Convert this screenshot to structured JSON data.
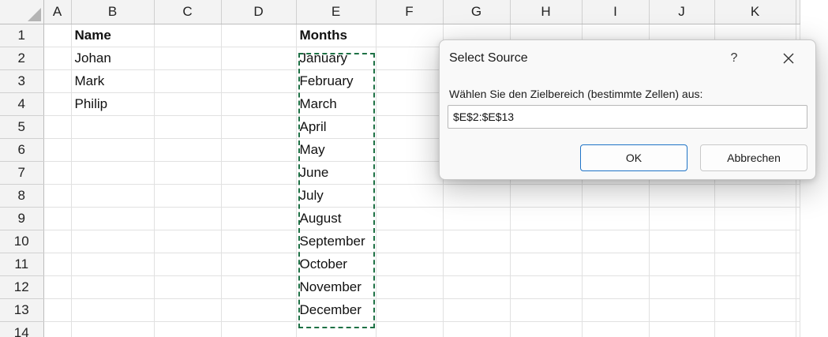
{
  "columns": [
    "A",
    "B",
    "C",
    "D",
    "E",
    "F",
    "G",
    "H",
    "I",
    "J",
    "K"
  ],
  "rows": [
    "1",
    "2",
    "3",
    "4",
    "5",
    "6",
    "7",
    "8",
    "9",
    "10",
    "11",
    "12",
    "13",
    "14"
  ],
  "cells": {
    "B1": "Name",
    "B2": "Johan",
    "B3": "Mark",
    "B4": "Philip",
    "E1": "Months",
    "E2": "January",
    "E3": "February",
    "E4": "March",
    "E5": "April",
    "E6": "May",
    "E7": "June",
    "E8": "July",
    "E9": "August",
    "E10": "September",
    "E11": "October",
    "E12": "November",
    "E13": "December"
  },
  "dialog": {
    "title": "Select Source",
    "help_label": "?",
    "prompt": "Wählen Sie den Zielbereich (bestimmte Zellen) aus:",
    "range_value": "$E$2:$E$13",
    "ok_label": "OK",
    "cancel_label": "Abbrechen"
  },
  "colors": {
    "selection_border": "#1e7145",
    "ok_border": "#1f74c7",
    "header_bg": "#f3f3f3"
  }
}
